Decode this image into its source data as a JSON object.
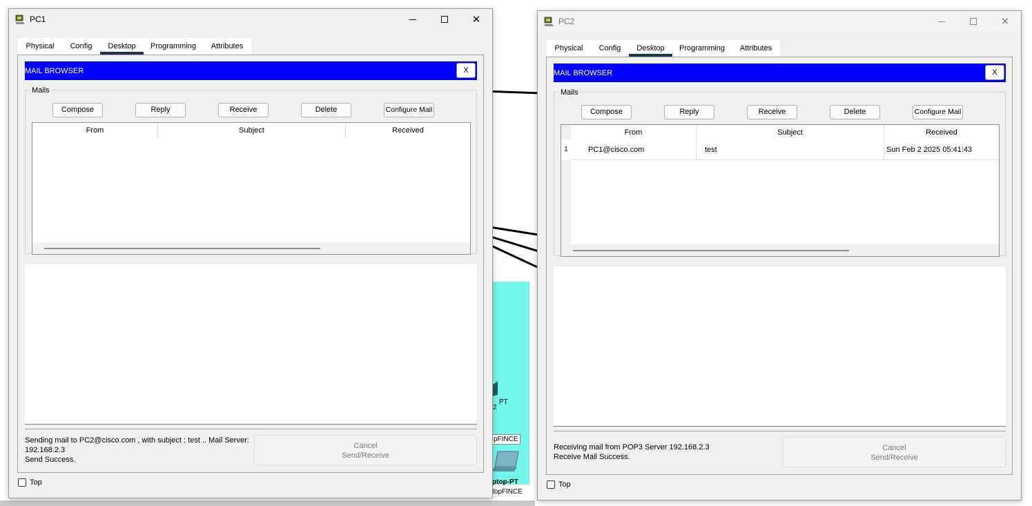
{
  "background": {
    "labels": [
      "PT",
      "2",
      "pFINCE",
      "ptop-PT",
      "topFINCE"
    ]
  },
  "pc1": {
    "title": "PC1",
    "tabs": [
      "Physical",
      "Config",
      "Desktop",
      "Programming",
      "Attributes"
    ],
    "active_tab": "Desktop",
    "mail_browser": {
      "title": "MAIL BROWSER",
      "close_label": "X",
      "group_label": "Mails",
      "buttons": {
        "compose": "Compose",
        "reply": "Reply",
        "receive": "Receive",
        "delete": "Delete",
        "configure": "Configure Mail"
      },
      "columns": [
        "From",
        "Subject",
        "Received"
      ],
      "rows": []
    },
    "status": {
      "line1": "Sending mail to PC2@cisco.com , with subject : test ..   Mail Server:",
      "line2": "192.168.2.3",
      "line3": "Send Success."
    },
    "cancel_button": {
      "line1": "Cancel",
      "line2": "Send/Receive"
    },
    "top_checkbox": {
      "label": "Top",
      "checked": false
    }
  },
  "pc2": {
    "title": "PC2",
    "tabs": [
      "Physical",
      "Config",
      "Desktop",
      "Programming",
      "Attributes"
    ],
    "active_tab": "Desktop",
    "mail_browser": {
      "title": "MAIL BROWSER",
      "close_label": "X",
      "group_label": "Mails",
      "buttons": {
        "compose": "Compose",
        "reply": "Reply",
        "receive": "Receive",
        "delete": "Delete",
        "configure": "Configure Mail"
      },
      "columns": [
        "From",
        "Subject",
        "Received"
      ],
      "rows": [
        {
          "num": "1",
          "from": "PC1@cisco.com",
          "subject": "test",
          "received": "Sun Feb 2 2025 05:41:43"
        }
      ]
    },
    "status": {
      "line1": "Receiving mail from POP3 Server 192.168.2.3",
      "line2": "Receive Mail Success."
    },
    "cancel_button": {
      "line1": "Cancel",
      "line2": "Send/Receive"
    },
    "top_checkbox": {
      "label": "Top",
      "checked": false
    }
  },
  "colors": {
    "mail_header": "#0000ff",
    "active_tab_underline": "#1c3557",
    "canvas_cyan": "#73f7eb"
  }
}
